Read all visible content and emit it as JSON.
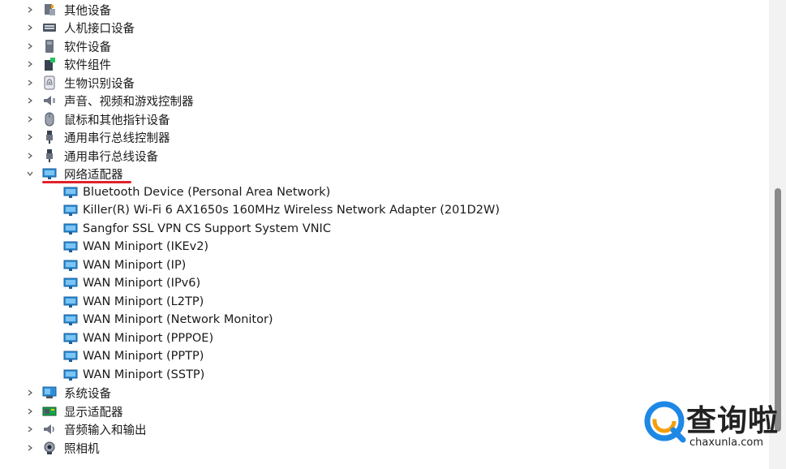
{
  "tree": {
    "categories_top": [
      {
        "label": "其他设备",
        "icon": "other-devices-icon"
      },
      {
        "label": "人机接口设备",
        "icon": "hid-icon"
      },
      {
        "label": "软件设备",
        "icon": "software-device-icon"
      },
      {
        "label": "软件组件",
        "icon": "software-component-icon"
      },
      {
        "label": "生物识别设备",
        "icon": "biometric-icon"
      },
      {
        "label": "声音、视频和游戏控制器",
        "icon": "sound-icon"
      },
      {
        "label": "鼠标和其他指针设备",
        "icon": "mouse-icon"
      },
      {
        "label": "通用串行总线控制器",
        "icon": "usb-icon"
      },
      {
        "label": "通用串行总线设备",
        "icon": "usb-icon"
      }
    ],
    "expanded": {
      "label": "网络适配器",
      "icon": "network-adapter-icon",
      "children": [
        "Bluetooth Device (Personal Area Network)",
        "Killer(R) Wi-Fi 6 AX1650s 160MHz Wireless Network Adapter (201D2W)",
        "Sangfor SSL VPN CS Support System VNIC",
        "WAN Miniport (IKEv2)",
        "WAN Miniport (IP)",
        "WAN Miniport (IPv6)",
        "WAN Miniport (L2TP)",
        "WAN Miniport (Network Monitor)",
        "WAN Miniport (PPPOE)",
        "WAN Miniport (PPTP)",
        "WAN Miniport (SSTP)"
      ]
    },
    "categories_bottom": [
      {
        "label": "系统设备",
        "icon": "system-device-icon"
      },
      {
        "label": "显示适配器",
        "icon": "display-adapter-icon"
      },
      {
        "label": "音频输入和输出",
        "icon": "audio-icon"
      },
      {
        "label": "照相机",
        "icon": "camera-icon"
      }
    ]
  },
  "watermark": {
    "text_cn": "查询啦",
    "text_en": "chaxunla.com"
  },
  "colors": {
    "highlight_underline": "#e0212b",
    "network_icon_blue": "#2d8fd6",
    "watermark_blue": "#1e88e5"
  }
}
